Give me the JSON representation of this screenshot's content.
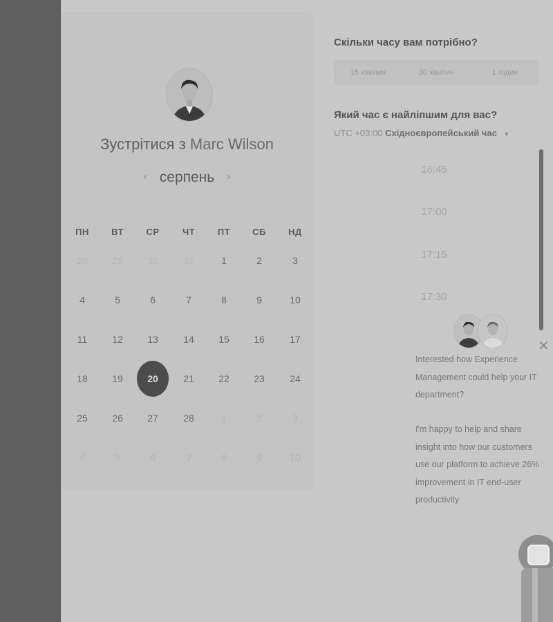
{
  "calendar": {
    "title_prefix": "Зустрітися з",
    "host_name": "Marc Wilson",
    "month": "серпень",
    "prev_icon": "chevron-left-icon",
    "next_icon": "chevron-right-icon",
    "weekdays": [
      "ПН",
      "ВТ",
      "СР",
      "ЧТ",
      "ПТ",
      "СБ",
      "НД"
    ],
    "weeks": [
      [
        "28",
        "29",
        "30",
        "31",
        "1",
        "2",
        "3"
      ],
      [
        "4",
        "5",
        "6",
        "7",
        "8",
        "9",
        "10"
      ],
      [
        "11",
        "12",
        "13",
        "14",
        "15",
        "16",
        "17"
      ],
      [
        "18",
        "19",
        "20",
        "21",
        "22",
        "23",
        "24"
      ],
      [
        "25",
        "26",
        "27",
        "28",
        "1",
        "2",
        "3"
      ],
      [
        "4",
        "5",
        "6",
        "7",
        "8",
        "9",
        "10"
      ]
    ],
    "selected_day": "20"
  },
  "duration": {
    "question": "Скільки часу вам потрібно?",
    "options": [
      "15 хвилин",
      "30 хвилин",
      "1 годин"
    ]
  },
  "time": {
    "question": "Який час є найліпшим для вас?",
    "timezone_offset": "UTC +03:00",
    "timezone_name": "Східноєвропейський час",
    "slots": [
      "16:45",
      "17:00",
      "17:15",
      "17:30"
    ]
  },
  "popup": {
    "message_1": "Interested how Experience Management could help your IT department?",
    "message_2": "I'm happy to help and share insight into how our customers use our platform to achieve 26% improvement in IT end-user productivity",
    "close_icon": "close-icon"
  },
  "colors": {
    "left_strip": "#5f5f5f",
    "selected_day_bg": "#4c4c4c",
    "page_bg": "#c8c8c8"
  }
}
